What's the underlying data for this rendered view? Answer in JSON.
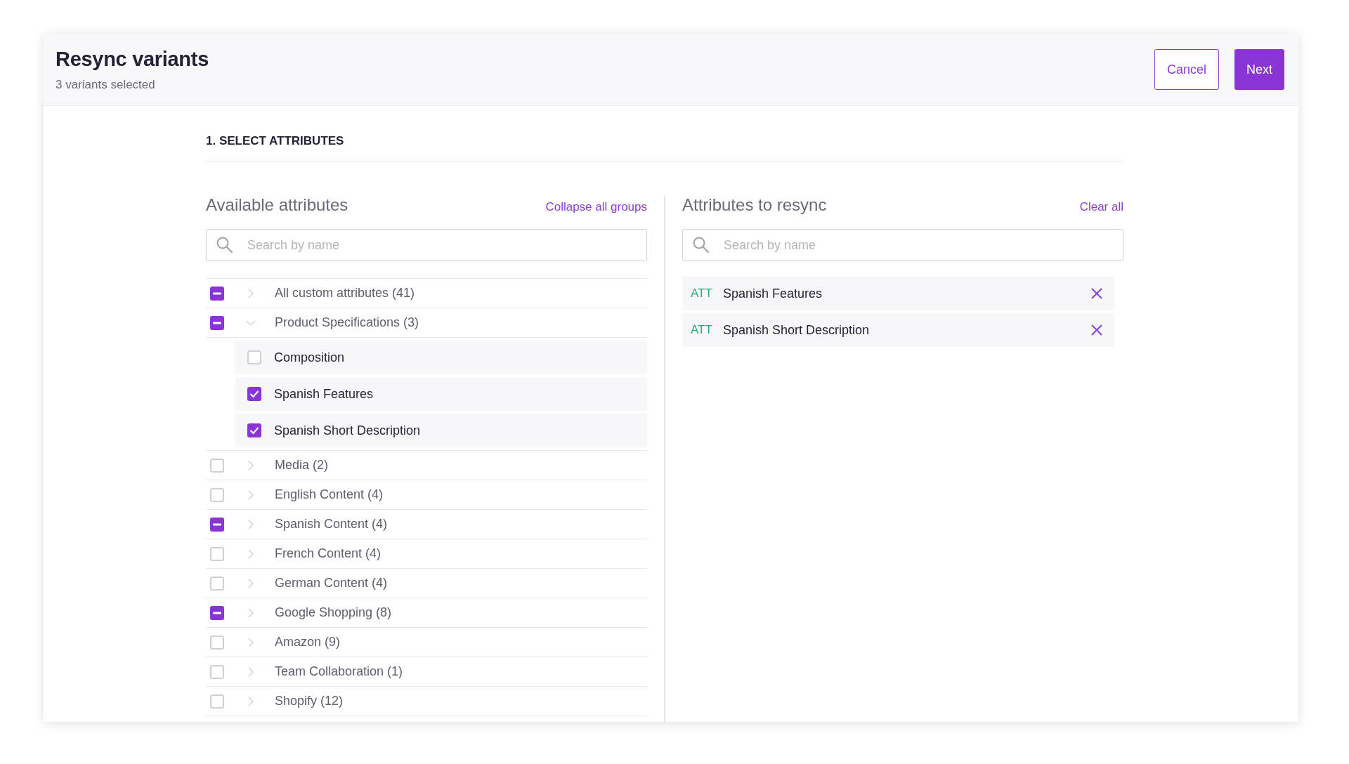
{
  "header": {
    "title": "Resync variants",
    "subtitle": "3 variants selected",
    "buttons": [
      {
        "label": "Cancel",
        "kind": "secondary"
      },
      {
        "label": "Next",
        "kind": "primary"
      }
    ]
  },
  "section_title": "1. SELECT ATTRIBUTES",
  "available": {
    "heading": "Available attributes",
    "action": "Collapse all groups",
    "search": {
      "placeholder": "Search by name"
    },
    "groups": [
      {
        "label": "All custom attributes (41)",
        "partial": true,
        "expanded": false
      },
      {
        "label": "Product Specifications (3)",
        "partial": true,
        "expanded": true,
        "children": [
          {
            "label": "Composition",
            "checked": false
          },
          {
            "label": "Spanish Features",
            "checked": true
          },
          {
            "label": "Spanish Short Description",
            "checked": true
          }
        ]
      },
      {
        "label": "Media (2)",
        "partial": false,
        "expanded": false
      },
      {
        "label": "English Content (4)",
        "partial": false,
        "expanded": false
      },
      {
        "label": "Spanish Content (4)",
        "partial": true,
        "expanded": false
      },
      {
        "label": "French Content (4)",
        "partial": false,
        "expanded": false
      },
      {
        "label": "German Content (4)",
        "partial": false,
        "expanded": false
      },
      {
        "label": "Google Shopping (8)",
        "partial": true,
        "expanded": false
      },
      {
        "label": "Amazon (9)",
        "partial": false,
        "expanded": false
      },
      {
        "label": "Team Collaboration (1)",
        "partial": false,
        "expanded": false
      },
      {
        "label": "Shopify (12)",
        "partial": false,
        "expanded": false
      }
    ]
  },
  "resync": {
    "heading": "Attributes to resync",
    "action": "Clear all",
    "search": {
      "placeholder": "Search by name"
    },
    "items": [
      {
        "tag": "ATT",
        "label": "Spanish Features"
      },
      {
        "tag": "ATT",
        "label": "Spanish Short Description"
      }
    ]
  }
}
